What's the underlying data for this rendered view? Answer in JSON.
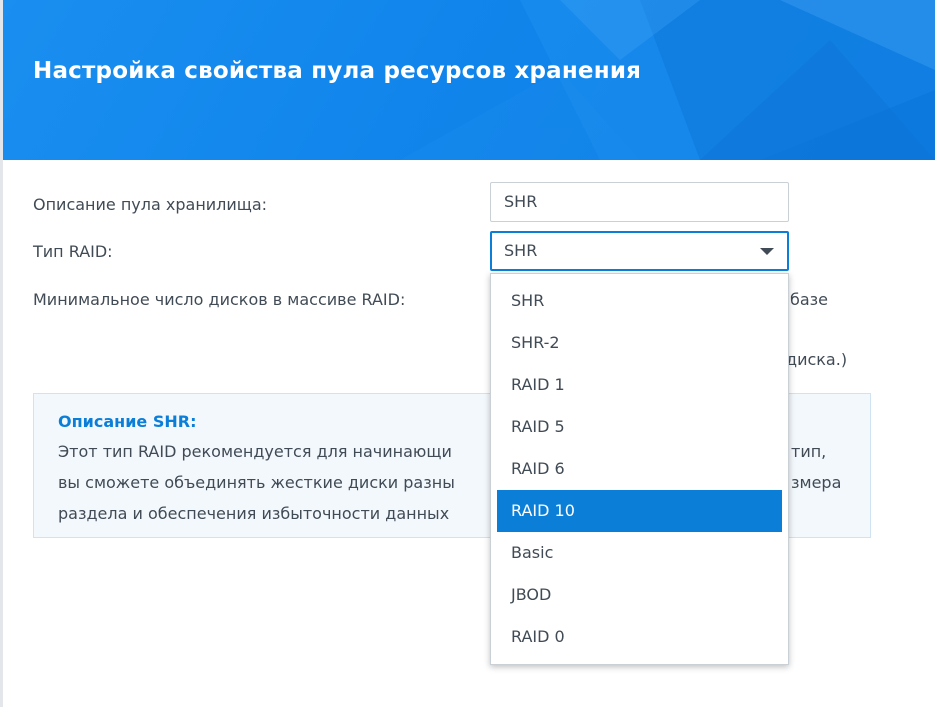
{
  "header": {
    "title": "Настройка свойства пула ресурсов хранения"
  },
  "form": {
    "description_label": "Описание пула хранилища:",
    "description_value": "SHR",
    "raid_type_label": "Тип RAID:",
    "raid_type_value": "SHR",
    "min_disks_label": "Минимальное число дисков в массиве RAID:",
    "min_disks_value_line1_fragment": "базе",
    "min_disks_value_line2_fragment": "диска.)"
  },
  "description_box": {
    "title": "Описание SHR:",
    "lines": [
      "Этот тип RAID рекомендуется для начинающи",
      "вы сможете объединять жесткие диски разны",
      "раздела и обеспечения избыточности данных"
    ],
    "line_fragments_right": [
      "тип,",
      "змера"
    ]
  },
  "dropdown": {
    "options": [
      "SHR",
      "SHR-2",
      "RAID 1",
      "RAID 5",
      "RAID 6",
      "RAID 10",
      "Basic",
      "JBOD",
      "RAID 0"
    ],
    "highlighted_index": 5
  },
  "colors": {
    "header_blue": "#1185eb",
    "accent": "#0b7fd8",
    "text": "#414b55",
    "desc_bg": "#f3f8fd"
  }
}
